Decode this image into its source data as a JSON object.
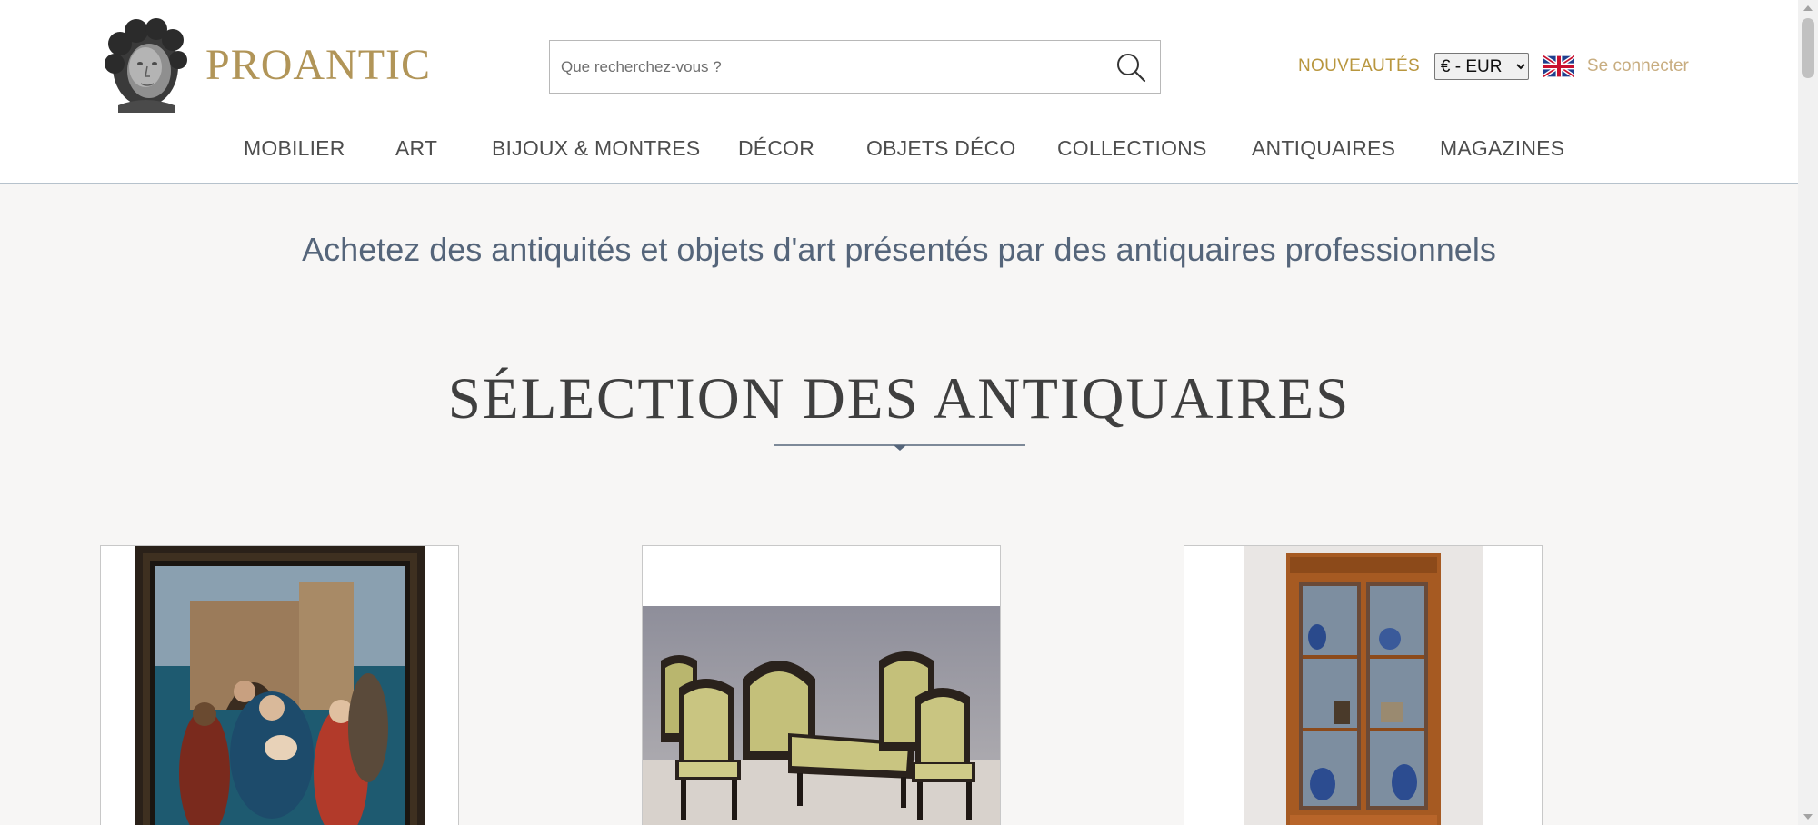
{
  "brand": {
    "name": "PROANTIC",
    "logo_icon": "classical-bust-logo",
    "color": "#b19558"
  },
  "search": {
    "placeholder": "Que recherchez-vous ?",
    "icon": "search-icon"
  },
  "header_links": {
    "nouveautes": "NOUVEAUTÉS",
    "currency_selected": "€ - EUR",
    "language_icon": "uk-flag-icon",
    "login": "Se connecter"
  },
  "nav": {
    "items": [
      {
        "label": "MOBILIER"
      },
      {
        "label": "ART"
      },
      {
        "label": "BIJOUX & MONTRES"
      },
      {
        "label": "DÉCOR"
      },
      {
        "label": "OBJETS DÉCO"
      },
      {
        "label": "COLLECTIONS"
      },
      {
        "label": "ANTIQUAIRES"
      },
      {
        "label": "MAGAZINES"
      }
    ]
  },
  "main": {
    "tagline": "Achetez des antiquités et objets d'art présentés par des antiquaires professionnels",
    "section_title": "SÉLECTION DES ANTIQUAIRES"
  },
  "cards": [
    {
      "image": "framed-religious-painting"
    },
    {
      "image": "green-upholstered-salon-set"
    },
    {
      "image": "wooden-display-cabinet"
    }
  ],
  "colors": {
    "accent_gold": "#b8963e",
    "login_gold": "#c8ad80",
    "tagline_blue": "#55657a",
    "divider": "#55657a",
    "background": "#f7f6f5"
  }
}
